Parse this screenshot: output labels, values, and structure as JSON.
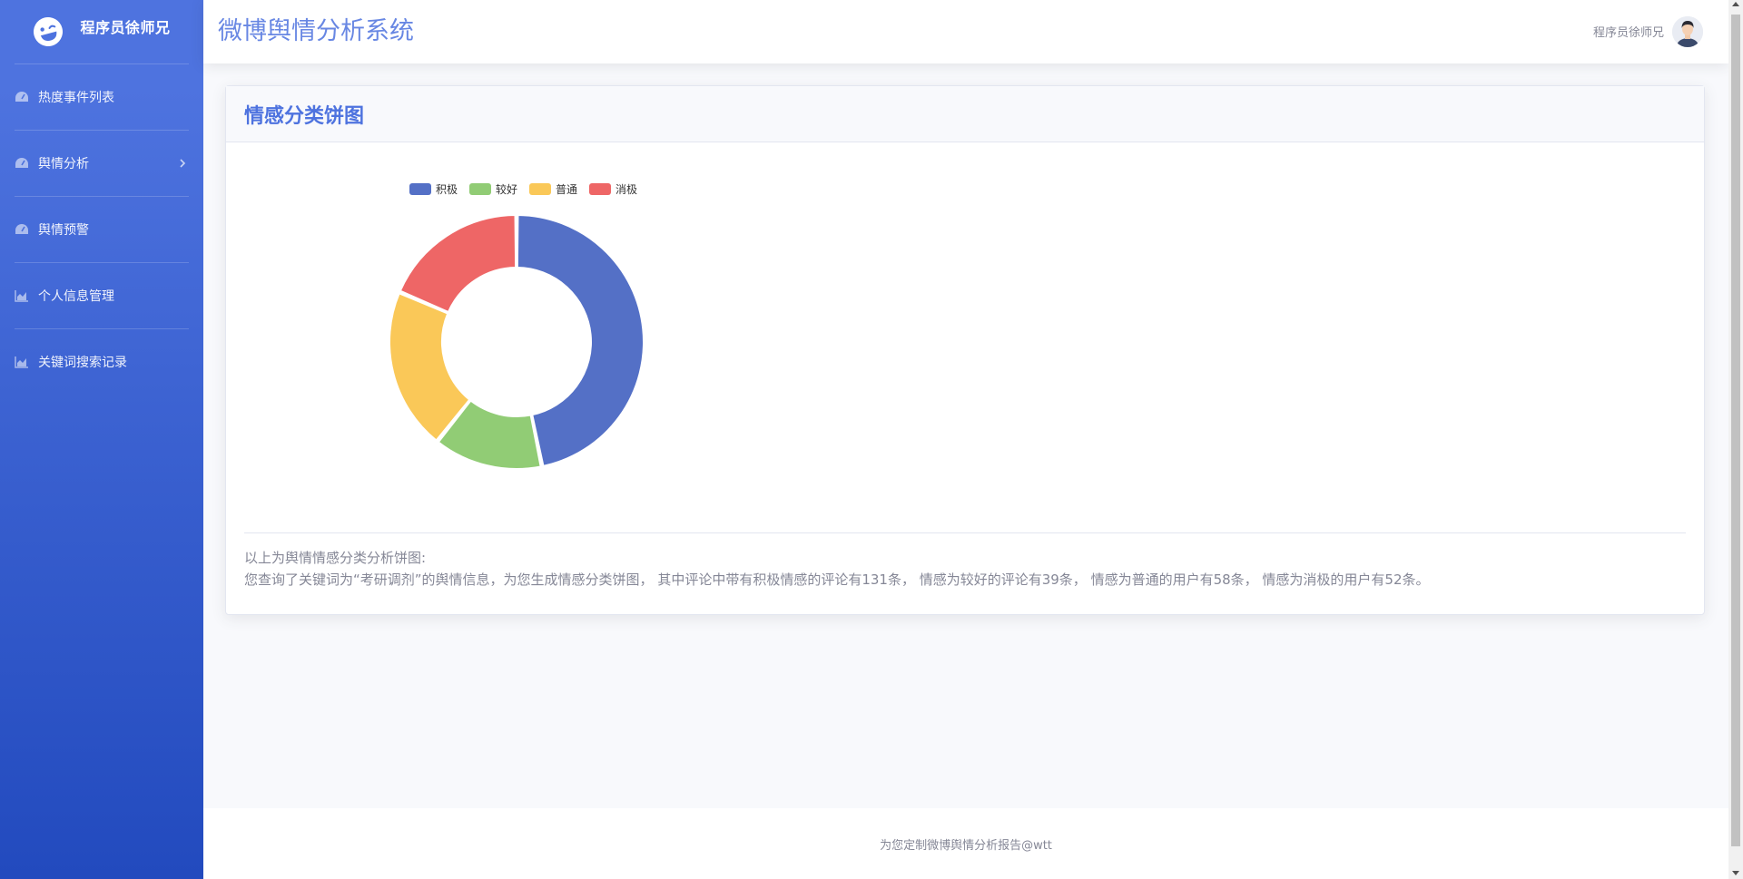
{
  "brand": {
    "name": "程序员徐师兄",
    "logo_icon": "laugh-wink-icon"
  },
  "sidebar": {
    "items": [
      {
        "label": "热度事件列表",
        "icon": "tachometer-icon",
        "has_submenu": false
      },
      {
        "label": "舆情分析",
        "icon": "tachometer-icon",
        "has_submenu": true
      },
      {
        "label": "舆情预警",
        "icon": "tachometer-icon",
        "has_submenu": false
      },
      {
        "label": "个人信息管理",
        "icon": "chart-area-icon",
        "has_submenu": false
      },
      {
        "label": "关键词搜索记录",
        "icon": "chart-area-icon",
        "has_submenu": false
      }
    ]
  },
  "topbar": {
    "title": "微博舆情分析系统",
    "user_name": "程序员徐师兄"
  },
  "card": {
    "title": "情感分类饼图",
    "desc_line1": "以上为舆情情感分类分析饼图:",
    "desc_line2": "您查询了关键词为“考研调剂”的舆情信息，为您生成情感分类饼图， 其中评论中带有积极情感的评论有131条， 情感为较好的评论有39条， 情感为普通的用户有58条， 情感为消极的用户有52条。"
  },
  "chart_data": {
    "type": "pie",
    "donut": true,
    "legend_position": "top",
    "slices": [
      {
        "name": "积极",
        "value": 131,
        "color": "#5470c6"
      },
      {
        "name": "较好",
        "value": 39,
        "color": "#91cc75"
      },
      {
        "name": "普通",
        "value": 58,
        "color": "#fac858"
      },
      {
        "name": "消极",
        "value": 52,
        "color": "#ee6666"
      }
    ]
  },
  "footer": {
    "text": "为您定制微博舆情分析报告@wtt"
  }
}
